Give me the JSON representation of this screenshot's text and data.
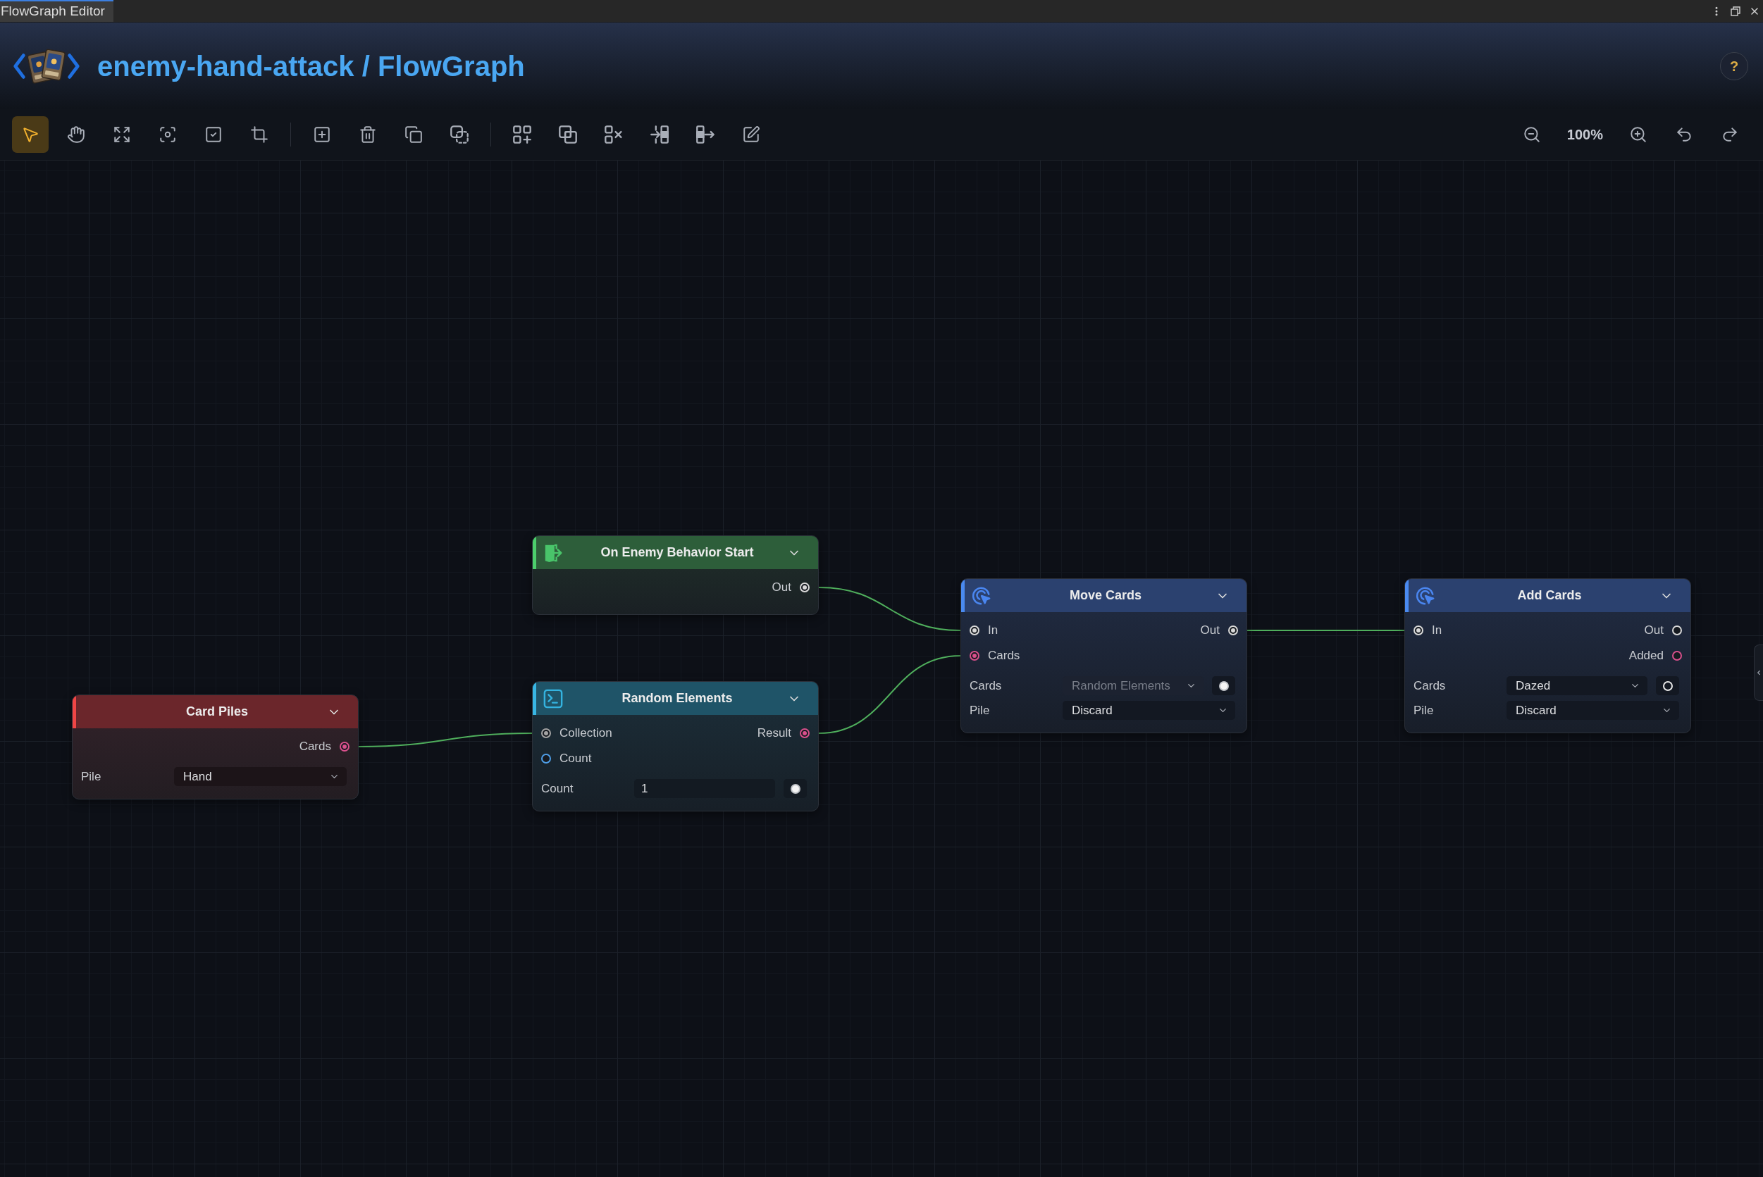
{
  "window": {
    "tabs": [
      {
        "label": "FlowGraph Editor",
        "selected": true
      }
    ]
  },
  "header": {
    "title": "enemy-hand-attack / FlowGraph",
    "help_button": "?"
  },
  "toolbar": {
    "tool_groups": [
      {
        "tools": [
          {
            "kind": "select",
            "selected": true
          },
          {
            "kind": "pan",
            "selected": false
          },
          {
            "kind": "fit",
            "selected": false
          },
          {
            "kind": "focus",
            "selected": false
          },
          {
            "kind": "select_all",
            "selected": false
          },
          {
            "kind": "crop",
            "selected": false
          }
        ]
      },
      {
        "tools": [
          {
            "kind": "add",
            "selected": false
          },
          {
            "kind": "delete",
            "selected": false
          },
          {
            "kind": "duplicate",
            "selected": false
          },
          {
            "kind": "copy_dashed",
            "selected": false
          }
        ]
      },
      {
        "tools": [
          {
            "kind": "group",
            "selected": false
          },
          {
            "kind": "combine",
            "selected": false
          },
          {
            "kind": "ungroup",
            "selected": false
          },
          {
            "kind": "insert",
            "selected": false
          },
          {
            "kind": "extract",
            "selected": false
          },
          {
            "kind": "edit",
            "selected": false
          }
        ]
      }
    ],
    "zoom_level": "100%"
  },
  "nodes": [
    {
      "title": "On Enemy Behavior Start",
      "kind": "event",
      "ports": [
        {
          "output": {
            "label": "Out",
            "color": "#d9d9d9",
            "connected": true
          }
        }
      ]
    },
    {
      "title": "Move Cards",
      "kind": "action",
      "ports": [
        {
          "input": {
            "label": "In",
            "color": "#d9d9d9",
            "connected": true
          },
          "output": {
            "label": "Out",
            "color": "#d9d9d9",
            "connected": true
          }
        },
        {
          "input": {
            "label": "Cards",
            "color": "#d9508c",
            "connected": true
          }
        }
      ],
      "fields": [
        {
          "label": "Cards",
          "kind": "dropdown",
          "value": "Random Elements",
          "disabled": true,
          "linked": true
        },
        {
          "label": "Pile",
          "kind": "dropdown",
          "value": "Discard",
          "disabled": false
        }
      ]
    },
    {
      "title": "Add Cards",
      "kind": "action",
      "ports": [
        {
          "input": {
            "label": "In",
            "color": "#d9d9d9",
            "connected": true
          },
          "output": {
            "label": "Out",
            "color": "#d9d9d9",
            "connected": false
          }
        },
        {
          "output": {
            "label": "Added",
            "color": "#d9508c",
            "connected": false
          }
        }
      ],
      "fields": [
        {
          "label": "Cards",
          "kind": "dropdown",
          "value": "Dazed",
          "disabled": false,
          "linked": false
        },
        {
          "label": "Pile",
          "kind": "dropdown",
          "value": "Discard",
          "disabled": false
        }
      ]
    },
    {
      "title": "Card Piles",
      "kind": "data",
      "ports": [
        {
          "output": {
            "label": "Cards",
            "color": "#d9508c",
            "connected": true
          }
        }
      ],
      "fields": [
        {
          "label": "Pile",
          "kind": "dropdown",
          "value": "Hand",
          "disabled": false
        }
      ]
    },
    {
      "title": "Random Elements",
      "kind": "function",
      "ports": [
        {
          "input": {
            "label": "Collection",
            "color": "#a3a3a3",
            "connected": true
          },
          "output": {
            "label": "Result",
            "color": "#d9508c",
            "connected": true
          }
        },
        {
          "input": {
            "label": "Count",
            "color": "#4f9fe8",
            "connected": false
          }
        }
      ],
      "fields": [
        {
          "label": "Count",
          "kind": "number",
          "value": "1",
          "disabled": false,
          "linked": true
        }
      ]
    }
  ]
}
